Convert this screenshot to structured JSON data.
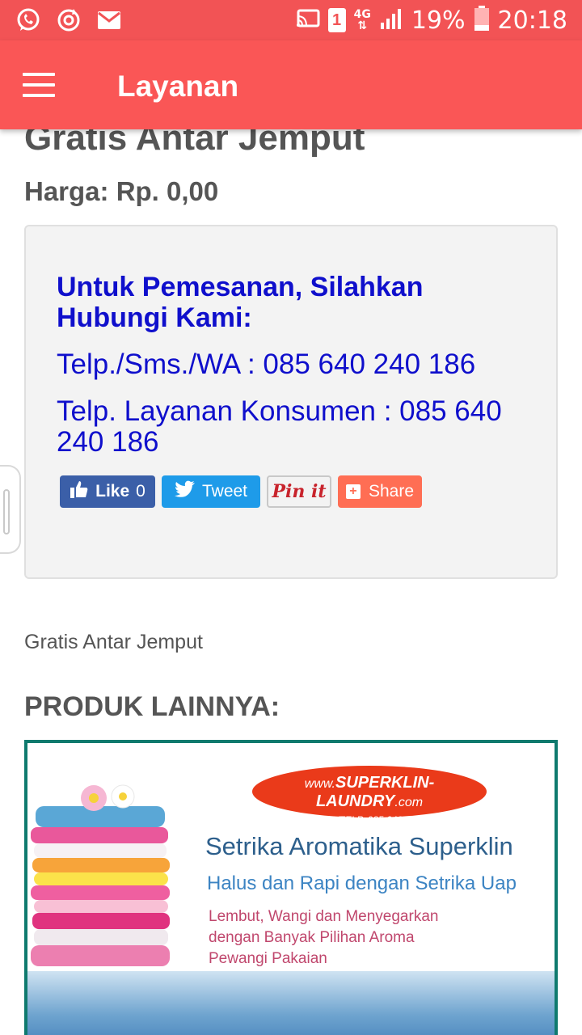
{
  "status_bar": {
    "left_icons": [
      "whatsapp-icon",
      "sync-icon",
      "mail-icon"
    ],
    "sim": "1",
    "network": "4G",
    "battery": "19%",
    "time": "20:18"
  },
  "app_bar": {
    "title": "Layanan",
    "menu_icon": "hamburger-menu-icon"
  },
  "product": {
    "title": "Gratis Antar Jemput",
    "price": "Harga: Rp. 0,00",
    "description": "Gratis Antar Jemput"
  },
  "contact": {
    "heading": "Untuk Pemesanan, Silahkan Hubungi Kami:",
    "line1": "Telp./Sms./WA : 085 640 240 186",
    "line2": "Telp. Layanan Konsumen : 085 640 240 186"
  },
  "share": {
    "like_label": "Like",
    "like_count": "0",
    "tweet_label": "Tweet",
    "pin_label": "Pin it",
    "share_label": "Share"
  },
  "other_products": {
    "heading": "PRODUK LAINNYA:",
    "banner": {
      "url_prefix": "www.",
      "url_brand": "SUPERKLIN-LAUNDRY",
      "url_suffix": ".com",
      "contact": "SMS/WA/TELP. 085 640 240 186",
      "title": "Setrika Aromatika Superklin",
      "subtitle": "Halus dan Rapi dengan Setrika Uap",
      "desc1": "Lembut, Wangi dan Menyegarkan",
      "desc2": "dengan Banyak Pilihan Aroma",
      "desc3": "Pewangi  Pakaian"
    }
  },
  "colors": {
    "app_bar": "#fa5656",
    "status_bar": "#f25355",
    "contact_text": "#0f0fcc",
    "facebook": "#3b5fa8",
    "twitter": "#1e9be9",
    "share": "#ff6e54"
  }
}
